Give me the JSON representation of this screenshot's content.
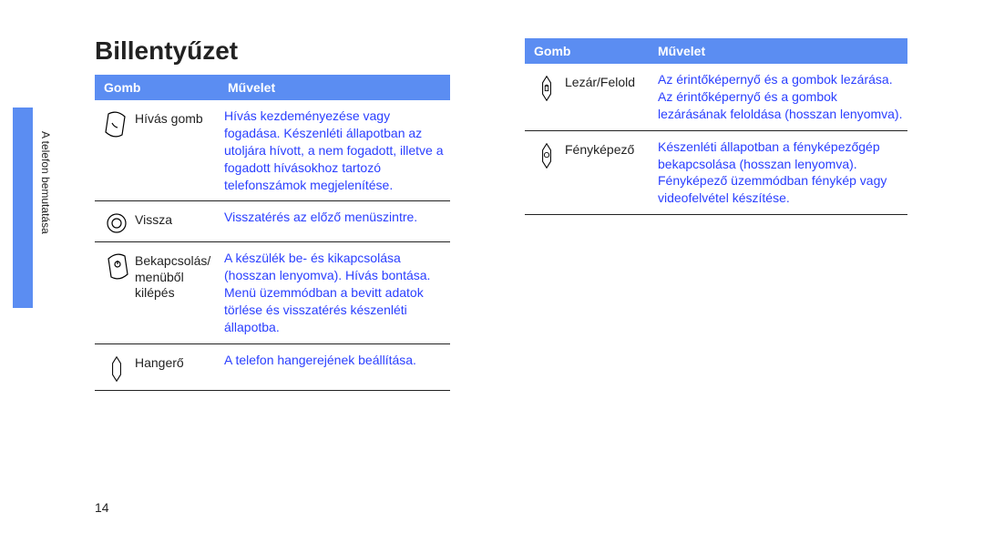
{
  "sidebar_label": "A telefon bemutatása",
  "heading": "Billentyűzet",
  "page_number": "14",
  "headers": {
    "col1": "Gomb",
    "col2": "Művelet"
  },
  "left_rows": [
    {
      "icon": "call-key-icon",
      "label": "Hívás gomb",
      "op": "Hívás kezdeményezése vagy fogadása. Készenléti állapotban az utoljára hívott, a nem fogadott, illetve a fogadott hívásokhoz tartozó telefonszámok megjelenítése."
    },
    {
      "icon": "back-icon",
      "label": "Vissza",
      "op": "Visszatérés az előző menüszintre."
    },
    {
      "icon": "power-exit-icon",
      "label": "Bekapcsolás/ menüből kilépés",
      "op": "A készülék be- és kikapcsolása (hosszan lenyomva). Hívás bontása. Menü üzemmódban a bevitt adatok törlése és visszatérés készenléti állapotba."
    },
    {
      "icon": "volume-icon",
      "label": "Hangerő",
      "op": "A telefon hangerejének beállítása."
    }
  ],
  "right_rows": [
    {
      "icon": "lock-icon",
      "label": "Lezár/Felold",
      "op": "Az érintőképernyő és a gombok lezárása. Az érintőképernyő és a gombok lezárásának feloldása (hosszan lenyomva)."
    },
    {
      "icon": "camera-icon",
      "label": "Fényképező",
      "op": "Készenléti állapotban a fényképezőgép bekapcsolása (hosszan lenyomva). Fényképező üzemmódban fénykép vagy videofelvétel készítése."
    }
  ]
}
